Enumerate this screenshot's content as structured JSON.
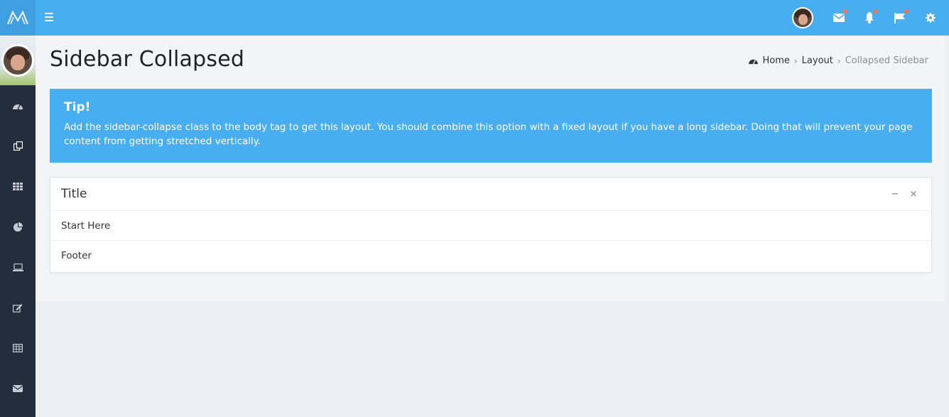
{
  "header": {
    "brand_icon": "logo-m",
    "menu_icon": "hamburger-icon",
    "right_icons": [
      "avatar",
      "mail-icon",
      "bell-icon",
      "flag-icon",
      "gear-icon"
    ],
    "accent_color": "#48aef2",
    "notification_dot_color": "#f2764e"
  },
  "sidebar": {
    "items": [
      {
        "icon": "dashboard-icon"
      },
      {
        "icon": "copy-icon"
      },
      {
        "icon": "grid-icon"
      },
      {
        "icon": "pie-chart-icon"
      },
      {
        "icon": "laptop-icon"
      },
      {
        "icon": "edit-icon"
      },
      {
        "icon": "table-icon"
      },
      {
        "icon": "envelope-icon"
      }
    ]
  },
  "page": {
    "title": "Sidebar Collapsed",
    "breadcrumb": {
      "home": "Home",
      "section": "Layout",
      "current": "Collapsed Sidebar"
    }
  },
  "tip": {
    "heading": "Tip!",
    "text": "Add the sidebar-collapse class to the body tag to get this layout. You should combine this option with a fixed layout if you have a long sidebar. Doing that will prevent your page content from getting stretched vertically."
  },
  "box": {
    "title": "Title",
    "body": "Start Here",
    "footer": "Footer",
    "collapse_label": "−",
    "close_label": "×"
  }
}
